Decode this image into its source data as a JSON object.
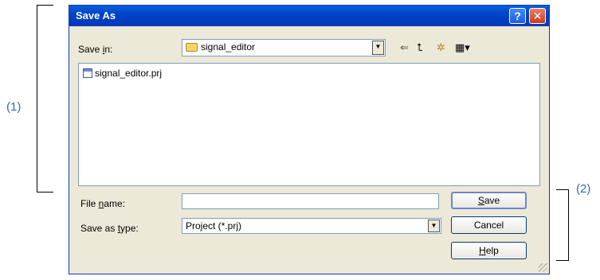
{
  "annotations": {
    "left": "(1)",
    "right": "(2)"
  },
  "dialog": {
    "title": "Save As",
    "help_glyph": "?",
    "close_glyph": "✕",
    "save_in_label_pre": "Save ",
    "save_in_label_key": "i",
    "save_in_label_post": "n:",
    "save_in_value": "signal_editor",
    "toolbar": {
      "back_glyph": "⇐",
      "up_glyph": "⮤",
      "new_folder_glyph": "✲",
      "view_glyph": "▦▾"
    },
    "files": [
      {
        "name": "signal_editor.prj"
      }
    ],
    "file_name_label_pre": "File ",
    "file_name_label_key": "n",
    "file_name_label_post": "ame:",
    "file_name_value": "",
    "save_type_label_pre": "Save as ",
    "save_type_label_key": "t",
    "save_type_label_post": "ype:",
    "save_type_value": "Project (*.prj)",
    "save_button_key": "S",
    "save_button_rest": "ave",
    "cancel_button": "Cancel",
    "help_button_key": "H",
    "help_button_rest": "elp",
    "dropdown_glyph": "▼"
  }
}
